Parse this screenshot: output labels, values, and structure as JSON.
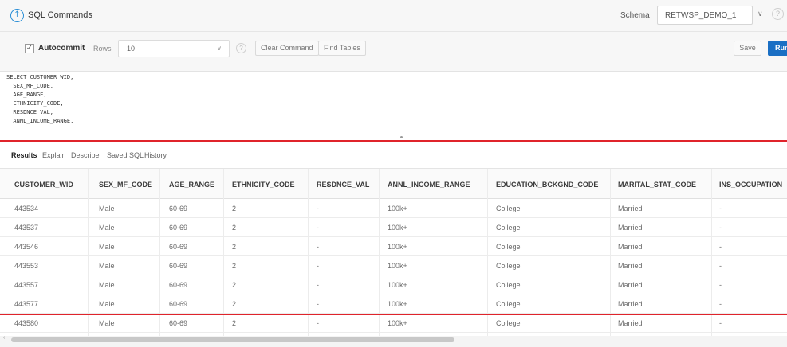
{
  "header": {
    "app_icon": "upload-circle-icon",
    "title": "SQL Commands",
    "schema_label": "Schema",
    "schema_value": "RETWSP_DEMO_1"
  },
  "toolbar": {
    "autocommit_label": "Autocommit",
    "autocommit_checked": true,
    "rows_label": "Rows",
    "rows_value": "10",
    "clear_command": "Clear Command",
    "find_tables": "Find Tables",
    "save": "Save",
    "run": "Run"
  },
  "editor": {
    "lines": [
      "SELECT CUSTOMER_WID,",
      "  SEX_MF_CODE,",
      "  AGE_RANGE,",
      "  ETHNICITY_CODE,",
      "  RESDNCE_VAL,",
      "  ANNL_INCOME_RANGE,"
    ]
  },
  "tabs": [
    "Results",
    "Explain",
    "Describe",
    "Saved SQL",
    "History"
  ],
  "table": {
    "columns": [
      "CUSTOMER_WID",
      "SEX_MF_CODE",
      "AGE_RANGE",
      "ETHNICITY_CODE",
      "RESDNCE_VAL",
      "ANNL_INCOME_RANGE",
      "EDUCATION_BCKGND_CODE",
      "MARITAL_STAT_CODE",
      "INS_OCCUPATION"
    ],
    "rows": [
      [
        "443534",
        "Male",
        "60-69",
        "2",
        "-",
        "100k+",
        "College",
        "Married",
        "-"
      ],
      [
        "443537",
        "Male",
        "60-69",
        "2",
        "-",
        "100k+",
        "College",
        "Married",
        "-"
      ],
      [
        "443546",
        "Male",
        "60-69",
        "2",
        "-",
        "100k+",
        "College",
        "Married",
        "-"
      ],
      [
        "443553",
        "Male",
        "60-69",
        "2",
        "-",
        "100k+",
        "College",
        "Married",
        "-"
      ],
      [
        "443557",
        "Male",
        "60-69",
        "2",
        "-",
        "100k+",
        "College",
        "Married",
        "-"
      ],
      [
        "443577",
        "Male",
        "60-69",
        "2",
        "-",
        "100k+",
        "College",
        "Married",
        "-"
      ],
      [
        "443580",
        "Male",
        "60-69",
        "2",
        "-",
        "100k+",
        "College",
        "Married",
        "-"
      ]
    ]
  },
  "colors": {
    "accent": "#1a6fc4",
    "annotation_red": "#e0242b",
    "icon_blue": "#2b8fd6"
  }
}
